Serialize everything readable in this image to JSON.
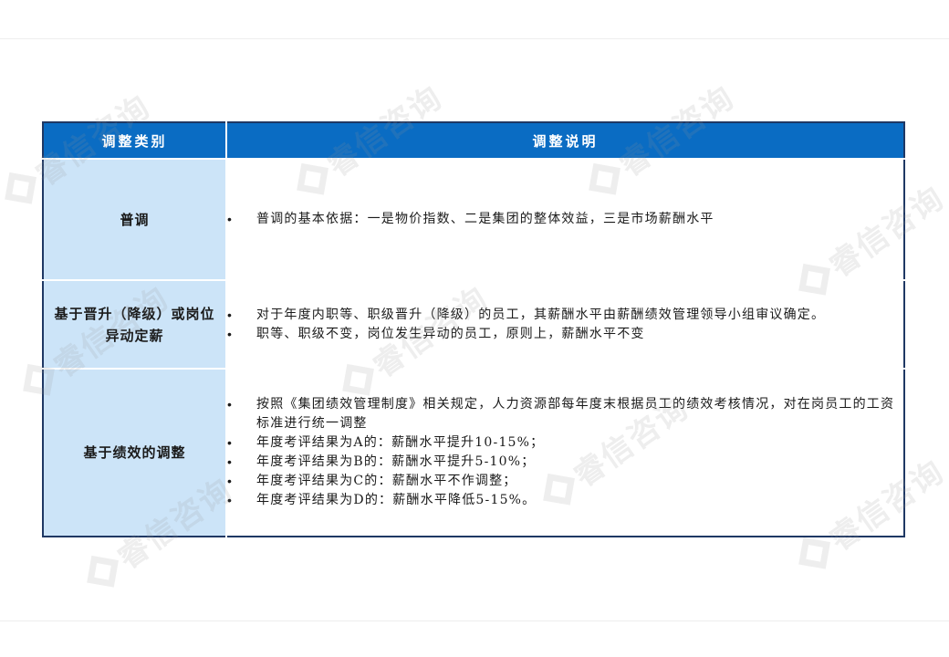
{
  "table": {
    "header": {
      "category": "调整类别",
      "description": "调整说明"
    },
    "rows": [
      {
        "category": "普调",
        "items": [
          "普调的基本依据：一是物价指数、二是集团的整体效益，三是市场薪酬水平"
        ]
      },
      {
        "category": "基于晋升（降级）或岗位异动定薪",
        "items": [
          "对于年度内职等、职级晋升（降级）的员工，其薪酬水平由薪酬绩效管理领导小组审议确定。",
          "职等、职级不变，岗位发生异动的员工，原则上，薪酬水平不变"
        ]
      },
      {
        "category": "基于绩效的调整",
        "items": [
          "按照《集团绩效管理制度》相关规定，人力资源部每年度末根据员工的绩效考核情况，对在岗员工的工资标准进行统一调整",
          "年度考评结果为A的：薪酬水平提升10-15%；",
          "年度考评结果为B的：薪酬水平提升5-10%；",
          "年度考评结果为C的：薪酬水平不作调整；",
          "年度考评结果为D的：薪酬水平降低5-15%。"
        ]
      }
    ]
  },
  "watermark": {
    "text": "睿信咨询"
  },
  "colors": {
    "header_bg": "#0a6cc3",
    "category_bg": "#cce4f8",
    "border": "#1f3864"
  }
}
